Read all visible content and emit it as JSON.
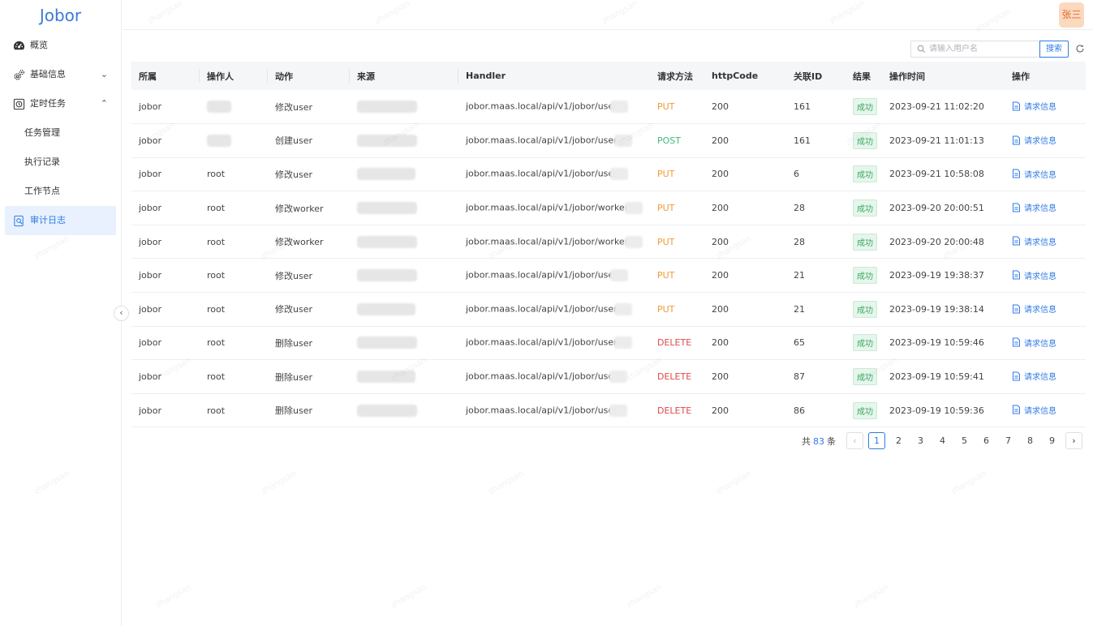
{
  "app": {
    "logo": "Jobor"
  },
  "user": {
    "name": "张三"
  },
  "sidebar": {
    "items": [
      {
        "label": "概览",
        "icon": "dashboard-icon"
      },
      {
        "label": "基础信息",
        "icon": "gears-icon",
        "chevron": "down"
      },
      {
        "label": "定时任务",
        "icon": "clock-icon",
        "chevron": "up"
      },
      {
        "label": "任务管理"
      },
      {
        "label": "执行记录"
      },
      {
        "label": "工作节点"
      },
      {
        "label": "审计日志",
        "icon": "audit-icon",
        "active": true
      }
    ]
  },
  "search": {
    "placeholder": "请输入用户名",
    "button_label": "搜索"
  },
  "table": {
    "headers": [
      "所属",
      "操作人",
      "动作",
      "来源",
      "Handler",
      "请求方法",
      "httpCode",
      "关联ID",
      "结果",
      "操作时间",
      "操作"
    ],
    "rows": [
      {
        "owner": "jobor",
        "operator": "",
        "action": "修改user",
        "handler": "jobor.maas.local/api/v1/jobor/use",
        "method": "PUT",
        "code": "200",
        "rel_id": "161",
        "result": "成功",
        "time": "2023-09-21 11:02:20",
        "op": "请求信息"
      },
      {
        "owner": "jobor",
        "operator": "",
        "action": "创建user",
        "handler": "jobor.maas.local/api/v1/jobor/user",
        "method": "POST",
        "code": "200",
        "rel_id": "161",
        "result": "成功",
        "time": "2023-09-21 11:01:13",
        "op": "请求信息"
      },
      {
        "owner": "jobor",
        "operator": "root",
        "action": "修改user",
        "handler": "jobor.maas.local/api/v1/jobor/use",
        "method": "PUT",
        "code": "200",
        "rel_id": "6",
        "result": "成功",
        "time": "2023-09-21 10:58:08",
        "op": "请求信息"
      },
      {
        "owner": "jobor",
        "operator": "root",
        "action": "修改worker",
        "handler": "jobor.maas.local/api/v1/jobor/worker",
        "method": "PUT",
        "code": "200",
        "rel_id": "28",
        "result": "成功",
        "time": "2023-09-20 20:00:51",
        "op": "请求信息"
      },
      {
        "owner": "jobor",
        "operator": "root",
        "action": "修改worker",
        "handler": "jobor.maas.local/api/v1/jobor/worker",
        "method": "PUT",
        "code": "200",
        "rel_id": "28",
        "result": "成功",
        "time": "2023-09-20 20:00:48",
        "op": "请求信息"
      },
      {
        "owner": "jobor",
        "operator": "root",
        "action": "修改user",
        "handler": "jobor.maas.local/api/v1/jobor/use",
        "method": "PUT",
        "code": "200",
        "rel_id": "21",
        "result": "成功",
        "time": "2023-09-19 19:38:37",
        "op": "请求信息"
      },
      {
        "owner": "jobor",
        "operator": "root",
        "action": "修改user",
        "handler": "jobor.maas.local/api/v1/jobor/user",
        "method": "PUT",
        "code": "200",
        "rel_id": "21",
        "result": "成功",
        "time": "2023-09-19 19:38:14",
        "op": "请求信息"
      },
      {
        "owner": "jobor",
        "operator": "root",
        "action": "删除user",
        "handler": "jobor.maas.local/api/v1/jobor/user",
        "method": "DELETE",
        "code": "200",
        "rel_id": "65",
        "result": "成功",
        "time": "2023-09-19 10:59:46",
        "op": "请求信息"
      },
      {
        "owner": "jobor",
        "operator": "root",
        "action": "删除user",
        "handler": "jobor.maas.local/api/v1/jobor/usc",
        "method": "DELETE",
        "code": "200",
        "rel_id": "87",
        "result": "成功",
        "time": "2023-09-19 10:59:41",
        "op": "请求信息"
      },
      {
        "owner": "jobor",
        "operator": "root",
        "action": "删除user",
        "handler": "jobor.maas.local/api/v1/jobor/usc",
        "method": "DELETE",
        "code": "200",
        "rel_id": "86",
        "result": "成功",
        "time": "2023-09-19 10:59:36",
        "op": "请求信息"
      }
    ]
  },
  "pagination": {
    "total_prefix": "共",
    "total": "83",
    "total_suffix": "条",
    "pages": [
      "1",
      "2",
      "3",
      "4",
      "5",
      "6",
      "7",
      "8",
      "9"
    ],
    "current": "1"
  },
  "colors": {
    "accent": "#2f7be5",
    "put": "#f09a35",
    "post": "#3fba79",
    "delete": "#e04a4a",
    "success": "#3aa864"
  },
  "watermark": "zhangsan"
}
